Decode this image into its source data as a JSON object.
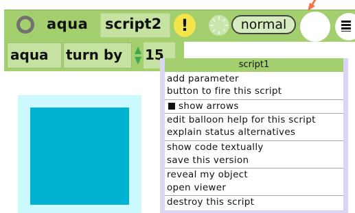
{
  "header": {
    "player_name": "aqua",
    "script_name": "script2",
    "exclaim_label": "!",
    "status": "normal"
  },
  "tile_row": {
    "object_label": "aqua",
    "command_label": "turn by",
    "value": "15"
  },
  "popup": {
    "title": "script1",
    "items": [
      "add parameter",
      "button to fire this script",
      "show arrows",
      "edit balloon help for this script",
      "explain status alternatives",
      "show code textually",
      "save this version",
      "reveal my object",
      "open viewer",
      "destroy this script"
    ]
  },
  "icons": {
    "circle": "circle-icon",
    "clock": "clock-icon",
    "menu": "menu-icon",
    "stepper": "stepper-arrows-icon",
    "checkbox": "checkbox-checked-icon"
  },
  "colors": {
    "header_green": "#a3cf6e",
    "tile_green": "#c6e2a0",
    "sprite_aqua": "#00b2d2",
    "sprite_halo": "#ccf8ff",
    "popup_border": "#d8d6f3",
    "exclaim_yellow": "#f4e64a",
    "arrow_orange": "#f0764a"
  }
}
